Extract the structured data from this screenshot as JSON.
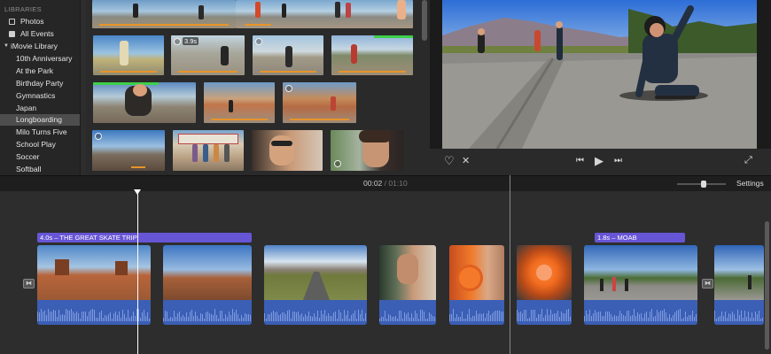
{
  "sidebar": {
    "header": "LIBRARIES",
    "items": [
      {
        "label": "Photos"
      },
      {
        "label": "All Events"
      },
      {
        "label": "iMovie Library"
      },
      {
        "label": "10th Anniversary"
      },
      {
        "label": "At the Park"
      },
      {
        "label": "Birthday Party"
      },
      {
        "label": "Gymnastics"
      },
      {
        "label": "Japan"
      },
      {
        "label": "Longboarding"
      },
      {
        "label": "Milo Turns Five"
      },
      {
        "label": "School Play"
      },
      {
        "label": "Soccer"
      },
      {
        "label": "Softball"
      }
    ],
    "selected": "Longboarding"
  },
  "browser": {
    "durations": [
      "3.9s"
    ]
  },
  "viewer": {
    "icons": [
      "heart-icon",
      "reject-icon",
      "skip-back-icon",
      "play-icon",
      "skip-forward-icon",
      "fullscreen-icon"
    ]
  },
  "toolbar": {
    "timecode_current": "00:02",
    "timecode_separator": "/",
    "timecode_total": "01:10",
    "settings_label": "Settings",
    "zoom_level": 0.55
  },
  "timeline": {
    "titles": [
      {
        "label": "4.0s – THE GREAT SKATE TRIP"
      },
      {
        "label": "1.8s – MOAB"
      }
    ]
  },
  "colors": {
    "accent_orange": "#e8942a",
    "title_purple": "#6656d6",
    "audio_blue": "#3b5fb5",
    "favorite_green": "#3ecf4a"
  }
}
